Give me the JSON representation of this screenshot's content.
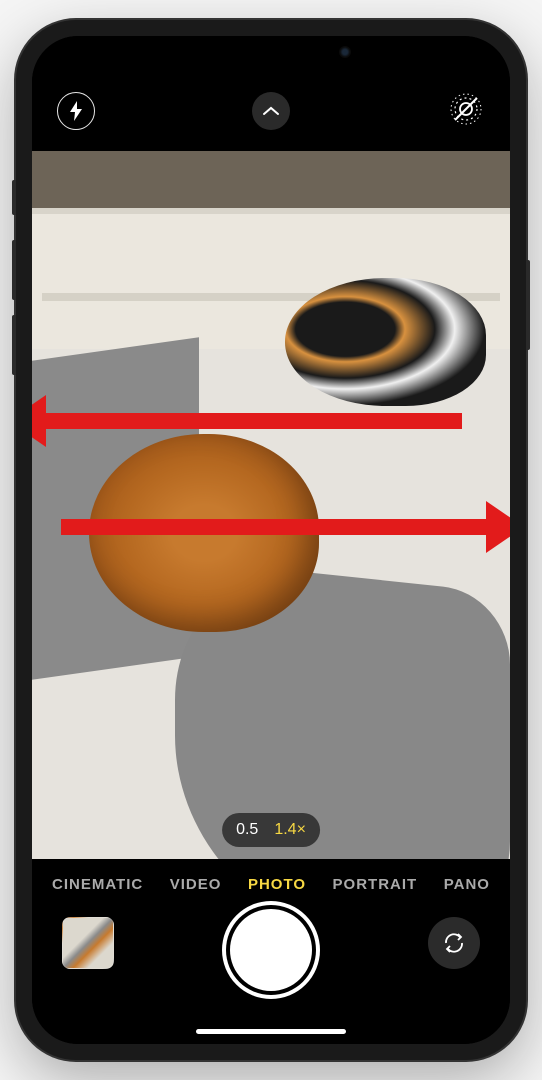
{
  "camera": {
    "zoom": {
      "options": [
        "0.5",
        "1.4×"
      ],
      "active_index": 1
    },
    "modes": {
      "items": [
        "CINEMATIC",
        "VIDEO",
        "PHOTO",
        "PORTRAIT",
        "PANO"
      ],
      "active_index": 2
    },
    "icons": {
      "flash": "flash-icon",
      "chevron": "chevron-up-icon",
      "live_photo_off": "live-photo-off-icon",
      "switch_camera": "switch-camera-icon"
    }
  },
  "annotation": {
    "arrows": [
      "swipe-left",
      "swipe-right"
    ]
  }
}
